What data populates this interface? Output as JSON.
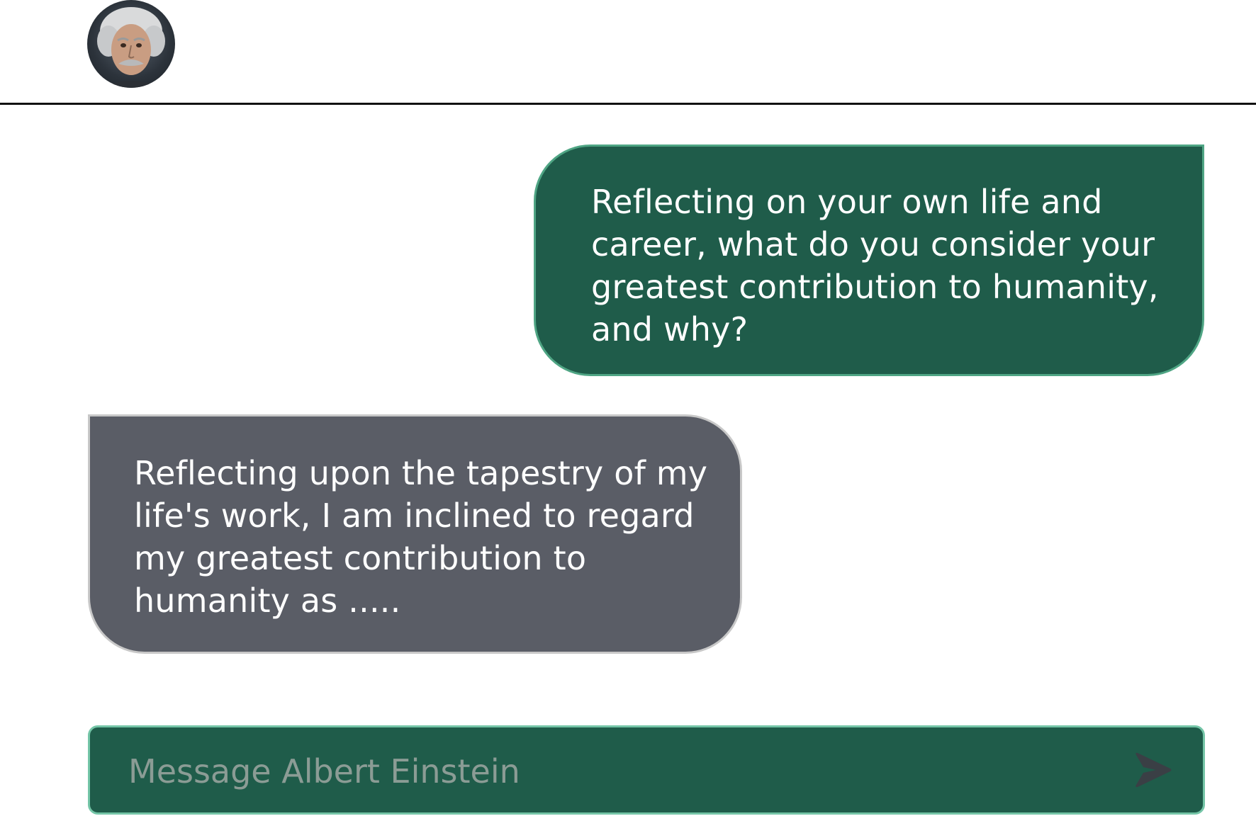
{
  "header": {
    "avatar_icon": "albert-einstein-portrait"
  },
  "messages": [
    {
      "role": "user",
      "text": "Reflecting on your own life and career, what do you consider your greatest contribution to humanity, and why?"
    },
    {
      "role": "assistant",
      "text": "Reflecting upon the tapestry of my life's work, I am inclined to regard my greatest contribution to humanity as ....."
    }
  ],
  "composer": {
    "placeholder": "Message Albert Einstein",
    "send_icon": "send-arrow-icon"
  },
  "colors": {
    "user_bubble": "#1f5c4a",
    "user_bubble_border": "#4fa584",
    "assistant_bubble": "#5a5d66",
    "assistant_bubble_border": "#c8c8c8",
    "composer_bg": "#1f5c4a",
    "composer_border": "#74c5a7"
  }
}
